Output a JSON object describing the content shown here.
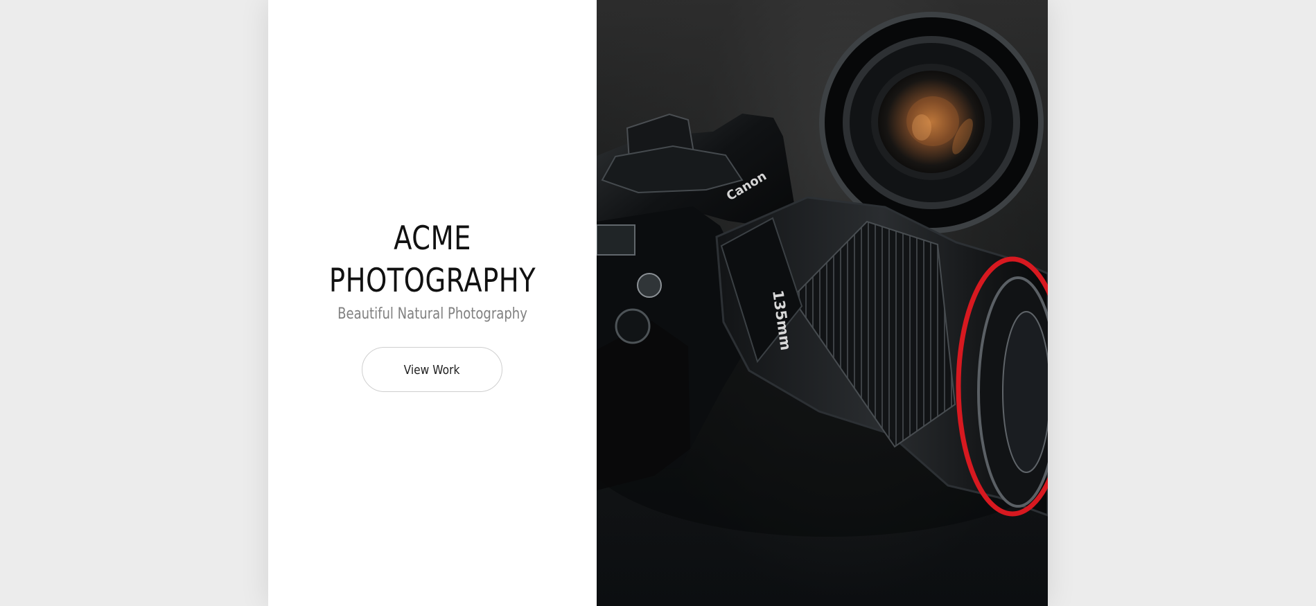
{
  "site": {
    "title_line_1": "ACME",
    "title_line_2": "PHOTOGRAPHY",
    "tagline": "Beautiful Natural Photography",
    "cta_label": "View Work"
  },
  "hero_image": {
    "subject": "camera-photo",
    "lens_marking": "135mm",
    "brand_marking": "Canon"
  },
  "colors": {
    "background": "#ececec",
    "panel": "#ffffff",
    "title": "#111111",
    "tagline": "#808080",
    "button_border": "#cfcfcf",
    "lens_red_ring": "#d71920"
  }
}
